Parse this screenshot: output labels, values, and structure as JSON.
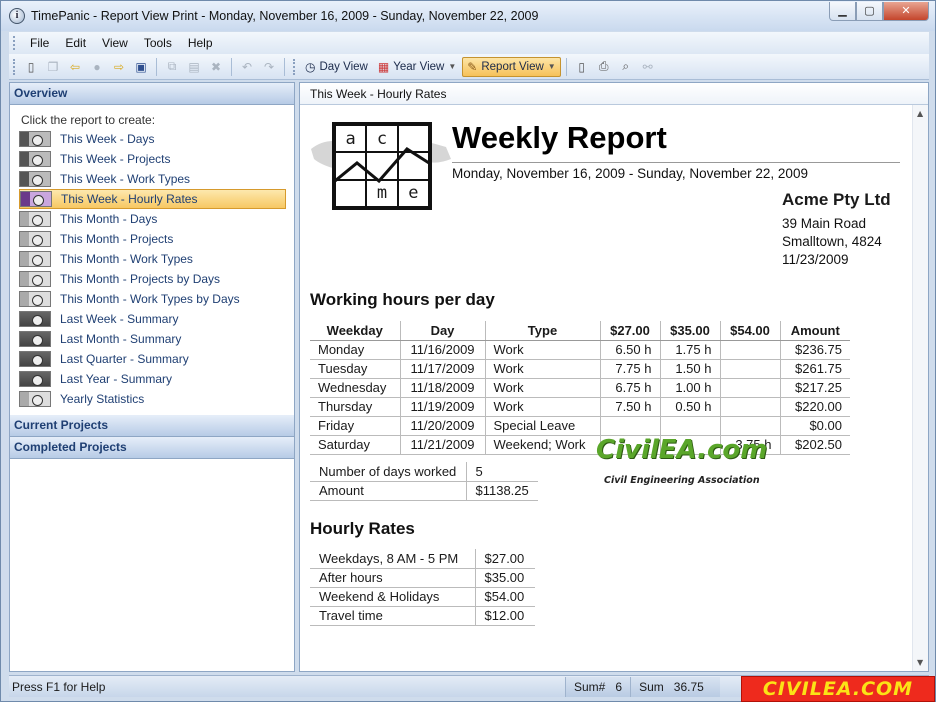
{
  "window": {
    "title": "TimePanic - Report View Print - Monday, November 16, 2009 - Sunday, November 22, 2009",
    "controls": {
      "minimize": "▁",
      "maximize": "▢",
      "close": "✕"
    }
  },
  "menu": [
    "File",
    "Edit",
    "View",
    "Tools",
    "Help"
  ],
  "toolbar": {
    "day_view": "Day View",
    "year_view": "Year View",
    "report_view": "Report View"
  },
  "left": {
    "overview_title": "Overview",
    "hint": "Click the report to create:",
    "items": [
      {
        "label": "This Week - Days",
        "kind": "week"
      },
      {
        "label": "This Week - Projects",
        "kind": "week"
      },
      {
        "label": "This Week - Work Types",
        "kind": "week"
      },
      {
        "label": "This Week - Hourly Rates",
        "kind": "week"
      },
      {
        "label": "This Month - Days",
        "kind": "month"
      },
      {
        "label": "This Month - Projects",
        "kind": "month"
      },
      {
        "label": "This Month - Work Types",
        "kind": "month"
      },
      {
        "label": "This Month - Projects by Days",
        "kind": "month"
      },
      {
        "label": "This Month - Work Types by Days",
        "kind": "month"
      },
      {
        "label": "Last Week - Summary",
        "kind": "summary"
      },
      {
        "label": "Last Month - Summary",
        "kind": "summary"
      },
      {
        "label": "Last Quarter - Summary",
        "kind": "summary"
      },
      {
        "label": "Last Year - Summary",
        "kind": "summary"
      },
      {
        "label": "Yearly Statistics",
        "kind": "month"
      }
    ],
    "selected_index": 3,
    "current_projects": "Current Projects",
    "completed_projects": "Completed Projects"
  },
  "right": {
    "header": "This Week - Hourly Rates",
    "logo_letters": [
      "a",
      "c",
      "m",
      "e"
    ],
    "title": "Weekly Report",
    "date_range": "Monday, November 16, 2009 - Sunday, November 22, 2009",
    "company": {
      "name": "Acme Pty Ltd",
      "address_lines": [
        "39 Main Road",
        "Smalltown, 4824",
        "11/23/2009"
      ]
    },
    "working_hours": {
      "title": "Working hours per day",
      "columns": [
        "Weekday",
        "Day",
        "Type",
        "$27.00",
        "$35.00",
        "$54.00",
        "Amount"
      ],
      "rows": [
        [
          "Monday",
          "11/16/2009",
          "Work",
          "6.50 h",
          "1.75 h",
          "",
          "$236.75"
        ],
        [
          "Tuesday",
          "11/17/2009",
          "Work",
          "7.75 h",
          "1.50 h",
          "",
          "$261.75"
        ],
        [
          "Wednesday",
          "11/18/2009",
          "Work",
          "6.75 h",
          "1.00 h",
          "",
          "$217.25"
        ],
        [
          "Thursday",
          "11/19/2009",
          "Work",
          "7.50 h",
          "0.50 h",
          "",
          "$220.00"
        ],
        [
          "Friday",
          "11/20/2009",
          "Special Leave",
          "",
          "",
          "",
          "$0.00"
        ],
        [
          "Saturday",
          "11/21/2009",
          "Weekend; Work",
          "",
          "",
          "3.75 h",
          "$202.50"
        ]
      ]
    },
    "totals": [
      [
        "Number of days worked",
        "5"
      ],
      [
        "Amount",
        "$1138.25"
      ]
    ],
    "hourly_rates": {
      "title": "Hourly Rates",
      "rows": [
        [
          "Weekdays, 8 AM - 5 PM",
          "$27.00"
        ],
        [
          "After hours",
          "$35.00"
        ],
        [
          "Weekend & Holidays",
          "$54.00"
        ],
        [
          "Travel time",
          "$12.00"
        ]
      ]
    },
    "watermark": {
      "main": "CivilEA.com",
      "sub": "Civil Engineering Association"
    }
  },
  "status": {
    "help": "Press F1 for Help",
    "sum_count_label": "Sum#",
    "sum_count": "6",
    "sum_label": "Sum",
    "sum_value": "36.75 h",
    "brand": "CIVILEA.COM"
  }
}
